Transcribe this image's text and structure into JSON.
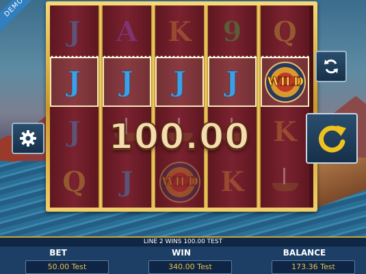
{
  "demo_badge": "DEMO",
  "reels": [
    [
      "J",
      "J",
      "J",
      "Q"
    ],
    [
      "A",
      "J",
      "ship",
      "J"
    ],
    [
      "K",
      "J",
      "ship",
      "WILD"
    ],
    [
      "9",
      "J",
      "ship",
      "K"
    ],
    [
      "Q",
      "WILD",
      "K",
      "ship"
    ]
  ],
  "winning_line": {
    "row": 1,
    "positions": [
      0,
      1,
      2,
      3,
      4
    ]
  },
  "win_amount": "100.00",
  "status_message": "LINE 2 WINS 100.00 TEST",
  "bet": {
    "label": "BET",
    "value": "50.00 Test"
  },
  "win": {
    "label": "WIN",
    "value": "340.00 Test"
  },
  "balance": {
    "label": "BALANCE",
    "value": "173.36 Test"
  },
  "buttons": {
    "settings_icon": "gear-icon",
    "autoplay_icon": "refresh-arrows-icon",
    "spin_icon": "spin-arrow-icon"
  },
  "colors": {
    "reel_background": "#7a2230",
    "frame_gold": "#e0b84a",
    "panel_blue": "#1d3f66",
    "value_text": "#e6c24a"
  }
}
